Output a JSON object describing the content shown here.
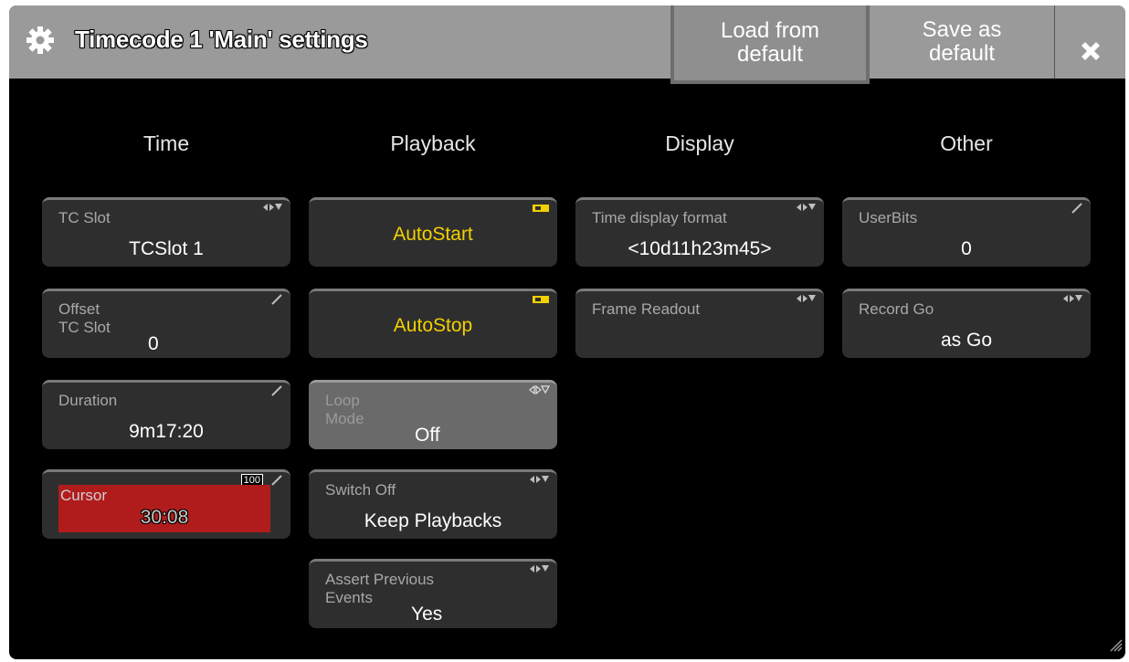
{
  "window": {
    "title": "Timecode 1 'Main' settings",
    "load_default_label": "Load from\ndefault",
    "save_default_label": "Save as\ndefault"
  },
  "columns": {
    "time": "Time",
    "playback": "Playback",
    "display": "Display",
    "other": "Other"
  },
  "time": {
    "tc_slot": {
      "label": "TC Slot",
      "value": "TCSlot 1"
    },
    "offset": {
      "label": "Offset\nTC Slot",
      "value": "0"
    },
    "duration": {
      "label": "Duration",
      "value": "9m17:20"
    },
    "cursor": {
      "label": "Cursor",
      "value": "30:08",
      "badge": "100"
    }
  },
  "playback": {
    "autostart": {
      "label": "AutoStart"
    },
    "autostop": {
      "label": "AutoStop"
    },
    "loop_mode": {
      "label": "Loop\nMode",
      "value": "Off"
    },
    "switch_off": {
      "label": "Switch Off",
      "value": "Keep Playbacks"
    },
    "assert_previous": {
      "label": "Assert Previous\nEvents",
      "value": "Yes"
    }
  },
  "display": {
    "time_display_format": {
      "label": "Time display format",
      "value": "<10d11h23m45>"
    },
    "frame_readout": {
      "label": "Frame Readout",
      "value": ""
    }
  },
  "other": {
    "userbits": {
      "label": "UserBits",
      "value": "0"
    },
    "record_go": {
      "label": "Record Go",
      "value": "as Go"
    }
  },
  "colors": {
    "accent_yellow": "#f2d000",
    "cursor_red": "#b01c1c",
    "titlebar": "#9a9a9a"
  },
  "icons": {
    "title": "gear-icon",
    "close": "close-icon",
    "select": "select-arrows-icon",
    "edit": "edit-pencil-icon",
    "toggle": "toggle-indicator-icon"
  }
}
